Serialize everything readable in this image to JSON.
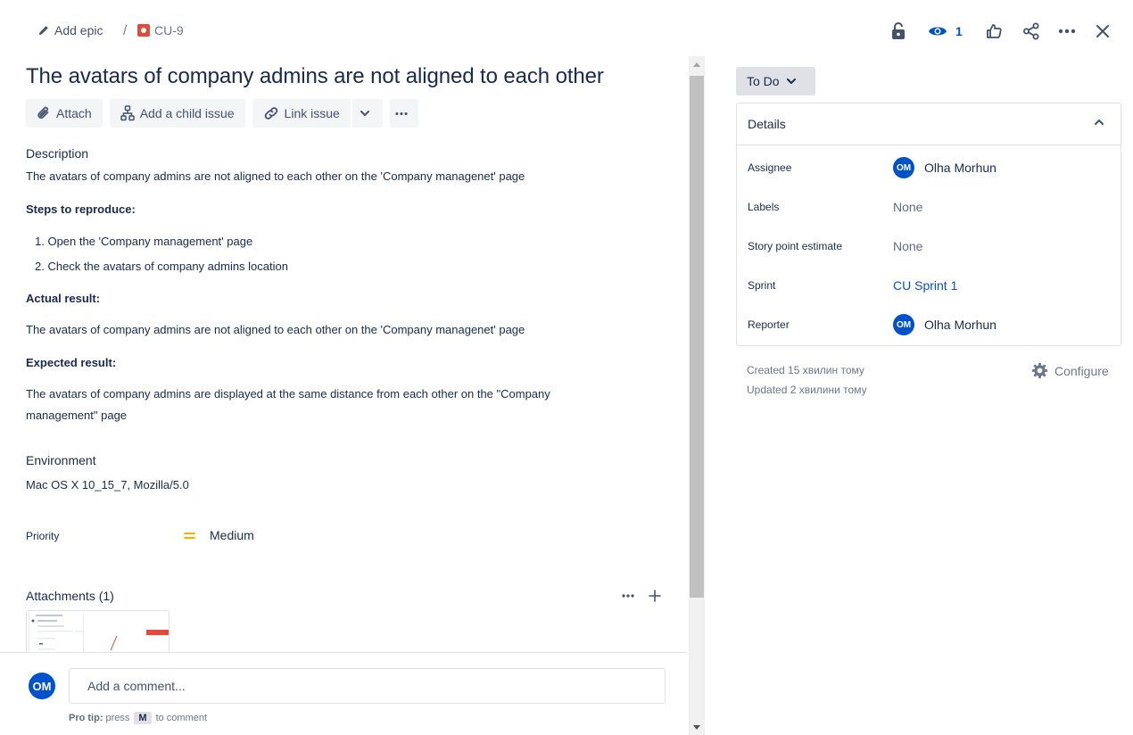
{
  "breadcrumb": {
    "epic_label": "Add epic",
    "separator": "/",
    "issue_key": "CU-9"
  },
  "top_actions": {
    "watch_count": "1"
  },
  "issue": {
    "title": "The avatars of company admins are not aligned to each other",
    "buttons": {
      "attach": "Attach",
      "add_child": "Add a child issue",
      "link_issue": "Link issue"
    },
    "description_label": "Description",
    "description_text": "The avatars of company admins are not aligned to each other on the 'Company managenet' page",
    "steps_label": "Steps to reproduce:",
    "steps": [
      "1. Open the 'Company management' page",
      "2. Check the avatars of company admins location"
    ],
    "actual_label": "Actual result:",
    "actual_text": "The avatars of company admins are not aligned to each other on the 'Company managenet' page",
    "expected_label": "Expected result:",
    "expected_text": "The avatars of company admins are displayed at the same distance from each other on the \"Company management\" page",
    "environment_label": "Environment",
    "environment_text": "Mac OS X 10_15_7, Mozilla/5.0",
    "priority_label": "Priority",
    "priority_value": "Medium",
    "attachments_label": "Attachments (1)"
  },
  "comment": {
    "avatar_initials": "OM",
    "placeholder": "Add a comment...",
    "pro_tip_label": "Pro tip:",
    "pro_tip_press": "press",
    "pro_tip_key": "M",
    "pro_tip_suffix": "to comment"
  },
  "sidebar": {
    "status": "To Do",
    "details_title": "Details",
    "fields": {
      "assignee_label": "Assignee",
      "assignee_initials": "OM",
      "assignee_name": "Olha Morhun",
      "labels_label": "Labels",
      "labels_value": "None",
      "story_points_label": "Story point estimate",
      "story_points_value": "None",
      "sprint_label": "Sprint",
      "sprint_value": "CU Sprint 1",
      "reporter_label": "Reporter",
      "reporter_initials": "OM",
      "reporter_name": "Olha Morhun"
    },
    "created": "Created 15 хвилин тому",
    "updated": "Updated 2 хвилини тому",
    "configure": "Configure"
  },
  "colors": {
    "brand_blue": "#0052cc",
    "bug_red": "#e5493a",
    "priority_medium": "#ffab00",
    "text": "#172b4d"
  },
  "icons": [
    "pencil-icon",
    "bug-icon",
    "lock-icon",
    "eye-icon",
    "thumbs-up-icon",
    "share-icon",
    "more-icon",
    "close-icon",
    "paperclip-icon",
    "child-issue-icon",
    "link-icon",
    "chevron-down-icon",
    "chevron-up-icon",
    "plus-icon",
    "gear-icon"
  ]
}
